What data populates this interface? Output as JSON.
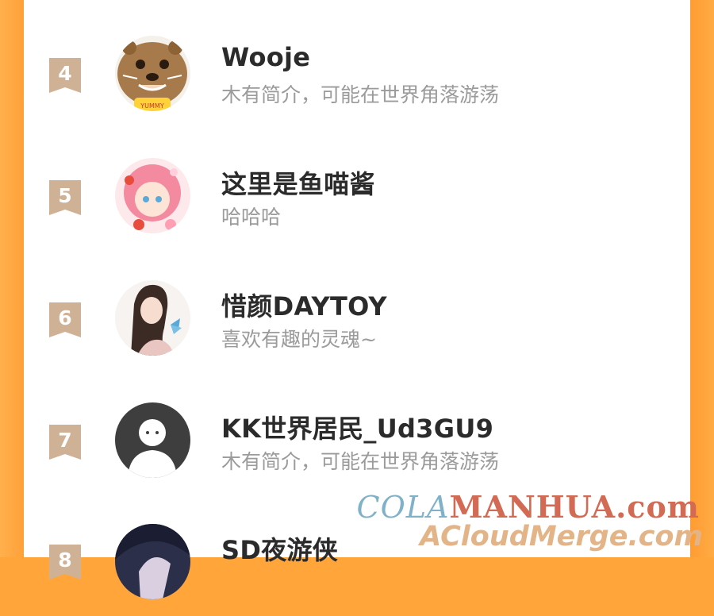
{
  "users": [
    {
      "rank": "4",
      "name": "Wooje",
      "bio": "木有简介，可能在世界角落游荡",
      "avatar_icon": "otter-avatar-icon"
    },
    {
      "rank": "5",
      "name": "这里是鱼喵酱",
      "bio": "哈哈哈",
      "avatar_icon": "pink-girl-avatar-icon"
    },
    {
      "rank": "6",
      "name": "惜颜DAYTOY",
      "bio": "喜欢有趣的灵魂~",
      "avatar_icon": "butterfly-girl-avatar-icon"
    },
    {
      "rank": "7",
      "name": "KK世界居民_Ud3GU9",
      "bio": "木有简介，可能在世界角落游荡",
      "avatar_icon": "default-avatar-icon"
    },
    {
      "rank": "8",
      "name": "SD夜游侠",
      "bio": "",
      "avatar_icon": "dark-hair-avatar-icon"
    }
  ],
  "watermark": {
    "line1_a": "COLA",
    "line1_b": "MANHUA.com",
    "line2": "ACloudMerge.com"
  },
  "colors": {
    "side": "#ffa53a",
    "rank_badge": "#cfb196",
    "name": "#2b2b2b",
    "bio": "#9b9b9b"
  }
}
